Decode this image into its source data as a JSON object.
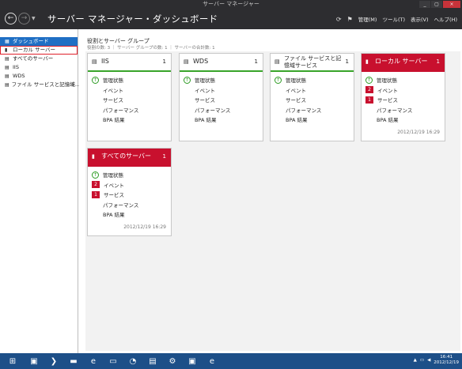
{
  "window": {
    "title": "サーバー マネージャー",
    "controls": [
      "_",
      "▢",
      "×"
    ]
  },
  "header": {
    "title": "サーバー マネージャー・ダッシュボード",
    "tools": {
      "refresh_icon": "refresh-icon",
      "flag_icon": "flag-icon",
      "manage": "管理(M)",
      "tools": "ツール(T)",
      "view": "表示(V)",
      "help": "ヘルプ(H)"
    }
  },
  "sidebar": {
    "items": [
      {
        "label": "ダッシュボード",
        "icon": "dashboard-icon",
        "glyph": "▦"
      },
      {
        "label": "ローカル サーバー",
        "icon": "server-icon",
        "glyph": "▮"
      },
      {
        "label": "すべてのサーバー",
        "icon": "servers-icon",
        "glyph": "▤"
      },
      {
        "label": "IIS",
        "icon": "iis-icon",
        "glyph": "▤"
      },
      {
        "label": "WDS",
        "icon": "wds-icon",
        "glyph": "▤"
      },
      {
        "label": "ファイル サービスと記憶域...",
        "icon": "file-services-icon",
        "glyph": "▤"
      }
    ]
  },
  "main": {
    "section_title": "役割とサーバー グループ",
    "section_sub": "役割の数: 3 ｜ サーバー グループの数: 1 ｜ サーバーの合計数: 1"
  },
  "tiles": [
    {
      "name": "IIS",
      "count": "1",
      "rows": [
        {
          "mark": "↑",
          "label": "管理状態"
        },
        {
          "mark": "",
          "label": "イベント"
        },
        {
          "mark": "",
          "label": "サービス"
        },
        {
          "mark": "",
          "label": "パフォーマンス"
        },
        {
          "mark": "",
          "label": "BPA 結果"
        }
      ],
      "timestamp": ""
    },
    {
      "name": "WDS",
      "count": "1",
      "rows": [
        {
          "mark": "↑",
          "label": "管理状態"
        },
        {
          "mark": "",
          "label": "イベント"
        },
        {
          "mark": "",
          "label": "サービス"
        },
        {
          "mark": "",
          "label": "パフォーマンス"
        },
        {
          "mark": "",
          "label": "BPA 結果"
        }
      ],
      "timestamp": ""
    },
    {
      "name": "ファイル サービスと記憶域サービス",
      "count": "1",
      "rows": [
        {
          "mark": "↑",
          "label": "管理状態"
        },
        {
          "mark": "",
          "label": "イベント"
        },
        {
          "mark": "",
          "label": "サービス"
        },
        {
          "mark": "",
          "label": "パフォーマンス"
        },
        {
          "mark": "",
          "label": "BPA 結果"
        }
      ],
      "timestamp": ""
    },
    {
      "name": "ローカル サーバー",
      "count": "1",
      "rows": [
        {
          "mark": "↑",
          "label": "管理状態"
        },
        {
          "mark": "2",
          "label": "イベント"
        },
        {
          "mark": "1",
          "label": "サービス"
        },
        {
          "mark": "",
          "label": "パフォーマンス"
        },
        {
          "mark": "",
          "label": "BPA 結果"
        }
      ],
      "timestamp": "2012/12/19 16:29"
    },
    {
      "name": "すべてのサーバー",
      "count": "1",
      "rows": [
        {
          "mark": "↑",
          "label": "管理状態"
        },
        {
          "mark": "2",
          "label": "イベント"
        },
        {
          "mark": "1",
          "label": "サービス"
        },
        {
          "mark": "",
          "label": "パフォーマンス"
        },
        {
          "mark": "",
          "label": "BPA 結果"
        }
      ],
      "timestamp": "2012/12/19 16:29"
    }
  ],
  "taskbar": {
    "apps": [
      {
        "name": "server-manager-icon",
        "glyph": "▣"
      },
      {
        "name": "powershell-icon",
        "glyph": "❯"
      },
      {
        "name": "cmd-icon",
        "glyph": "▬"
      },
      {
        "name": "ie-icon",
        "glyph": "e"
      },
      {
        "name": "explorer-icon",
        "glyph": "▭"
      },
      {
        "name": "clock-app-icon",
        "glyph": "◔"
      },
      {
        "name": "iis-manager-icon",
        "glyph": "▤"
      },
      {
        "name": "services-icon",
        "glyph": "⚙"
      },
      {
        "name": "remote-desktop-icon",
        "glyph": "▣"
      },
      {
        "name": "ie2-icon",
        "glyph": "e"
      }
    ],
    "time": "16:41",
    "date": "2012/12/19"
  },
  "colors": {
    "alert": "#c8102e",
    "ok": "#38a42a",
    "header": "#2d2d30",
    "selected": "#1f6fc4",
    "taskbar": "#1d4f88"
  }
}
